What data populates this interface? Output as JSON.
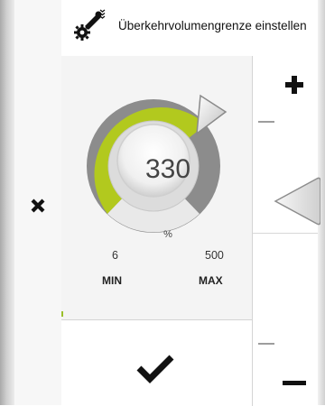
{
  "header": {
    "title": "Überkehrvolumengrenze einstellen",
    "icon": "harvester-settings-icon"
  },
  "dial": {
    "value": "330",
    "unit": "%",
    "min": "6",
    "max": "500",
    "min_label": "MIN",
    "max_label": "MAX",
    "fill_fraction": 0.64,
    "accent_color": "#b2c91e",
    "track_color": "#8a8a8a"
  },
  "controls": {
    "close_icon": "close-icon",
    "confirm_icon": "checkmark-icon",
    "increase_icon": "plus-icon",
    "decrease_icon": "minus-icon",
    "back_icon": "arrow-left-icon"
  }
}
